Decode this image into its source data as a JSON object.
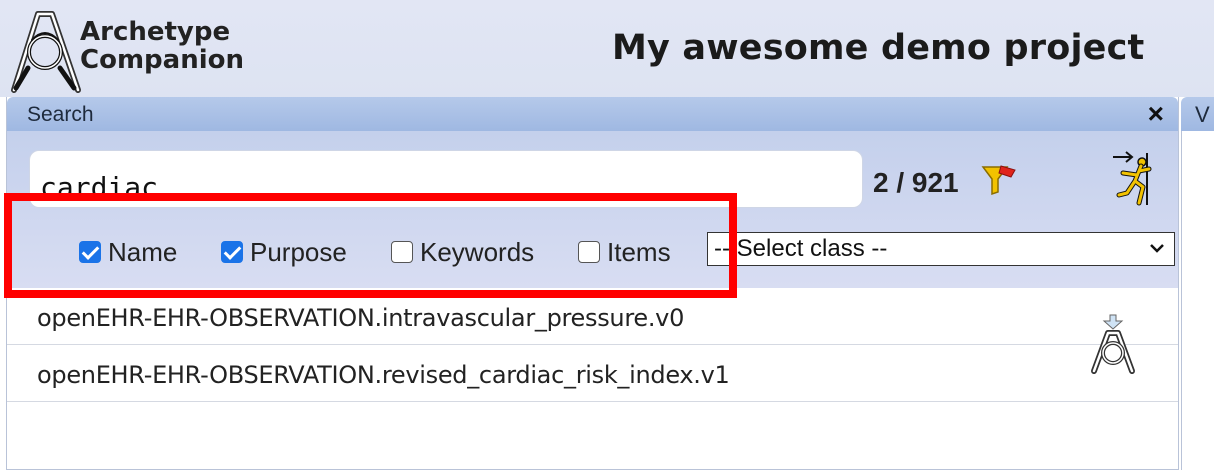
{
  "app": {
    "logo_line1": "Archetype",
    "logo_line2": "Companion",
    "project_title": "My awesome demo project"
  },
  "search_panel": {
    "title": "Search",
    "close_label": "×",
    "query": "cardiac",
    "count": "2 / 921",
    "options": [
      {
        "label": "Name",
        "checked": true
      },
      {
        "label": "Purpose",
        "checked": true
      },
      {
        "label": "Keywords",
        "checked": false
      },
      {
        "label": "Items",
        "checked": false
      }
    ],
    "class_select": "-- Select class --",
    "results": [
      "openEHR-EHR-OBSERVATION.intravascular_pressure.v0",
      "openEHR-EHR-OBSERVATION.revised_cardiac_risk_index.v1"
    ]
  },
  "right_tab": {
    "label": "V"
  },
  "colors": {
    "accent_checkbox": "#1a73e8",
    "highlight": "#ff0000",
    "titlebar": "#a9c0e6"
  },
  "icons": [
    "archetype-logo-icon",
    "filter-icon",
    "export-icon",
    "import-archetype-icon",
    "close-icon"
  ]
}
